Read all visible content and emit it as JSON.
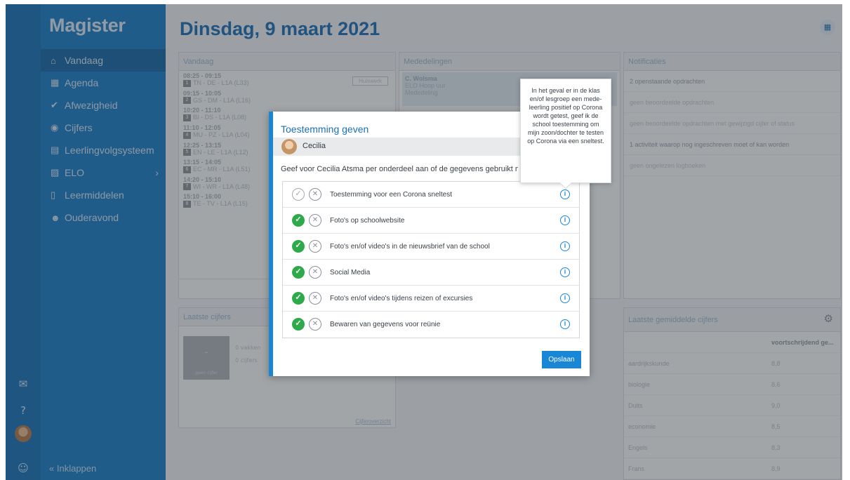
{
  "app": {
    "logo": "Magister",
    "page_title": "Dinsdag, 9 maart 2021"
  },
  "sidebar": {
    "items": [
      {
        "label": "Vandaag",
        "icon": "home-icon"
      },
      {
        "label": "Agenda",
        "icon": "calendar-icon"
      },
      {
        "label": "Afwezigheid",
        "icon": "check-circle-icon"
      },
      {
        "label": "Cijfers",
        "icon": "grades-icon"
      },
      {
        "label": "Leerlingvolgsysteem",
        "icon": "report-icon"
      },
      {
        "label": "ELO",
        "icon": "elo-icon"
      },
      {
        "label": "Leermiddelen",
        "icon": "books-icon"
      },
      {
        "label": "Ouderavond",
        "icon": "parents-icon"
      }
    ],
    "collapse_label": "Inklappen"
  },
  "today": {
    "title": "Vandaag",
    "homework_label": "Huiswerk",
    "lessons": [
      {
        "time": "08:25 - 09:15",
        "num": "1",
        "info": "TN - DE - L1A (L33)"
      },
      {
        "time": "09:15 - 10:05",
        "num": "2",
        "info": "GS - DM - L1A (L16)"
      },
      {
        "time": "10:20 - 11:10",
        "num": "3",
        "info": "BI - DS - L1A (L08)"
      },
      {
        "time": "11:10 - 12:05",
        "num": "4",
        "info": "MU - PZ - L1A (L04)"
      },
      {
        "time": "12:25 - 13:15",
        "num": "5",
        "info": "EN - LE - L1A (L12)"
      },
      {
        "time": "13:15 - 14:05",
        "num": "6",
        "info": "EC - MR - L1A (L51)"
      },
      {
        "time": "14:20 - 15:10",
        "num": "7",
        "info": "WI - WR - L1A (L48)"
      },
      {
        "time": "15:10 - 16:00",
        "num": "8",
        "info": "TE - TV - L1A (L15)"
      }
    ]
  },
  "mededelingen": {
    "title": "Mededelingen",
    "item": {
      "name": "C. Wolsma",
      "line1": "ELO Hoop uur",
      "line2": "Mededeling"
    }
  },
  "notificaties": {
    "title": "Notificaties",
    "rows": [
      {
        "text": "2 openstaande opdrachten",
        "dark": true
      },
      {
        "text": "geen beoordeelde opdrachten",
        "dark": false
      },
      {
        "text": "geen beoordeelde opdrachten met gewijzigd cijfer of status",
        "dark": false
      },
      {
        "text": "1 activiteit waarop nog ingeschreven moet of kan worden",
        "dark": true
      },
      {
        "text": "geen ongelezen logboeken",
        "dark": false
      }
    ]
  },
  "laatste_cijfers": {
    "title": "Laatste cijfers",
    "tile_value": "–",
    "tile_sub": "geen cijfer",
    "link": "Cijferoverzicht",
    "lines": [
      "0 vakken",
      "0 cijfers"
    ]
  },
  "gemiddelde": {
    "title": "Laatste gemiddelde cijfers",
    "column_header": "voortschrijdend ge...",
    "rows": [
      {
        "subject": "aardrijkskunde",
        "value": "8,8"
      },
      {
        "subject": "biologie",
        "value": "8,6"
      },
      {
        "subject": "Duits",
        "value": "9,0"
      },
      {
        "subject": "economie",
        "value": "8,5"
      },
      {
        "subject": "Engels",
        "value": "8,3"
      },
      {
        "subject": "Frans",
        "value": "8,9"
      }
    ]
  },
  "modal": {
    "title": "Toestemming geven",
    "user": "Cecilia",
    "intro": "Geef voor Cecilia Atsma per onderdeel aan of de gegevens gebruikt mogen worden.",
    "items": [
      {
        "label": "Toestemming voor een Corona sneltest",
        "given": false
      },
      {
        "label": "Foto's op schoolwebsite",
        "given": true
      },
      {
        "label": "Foto's en/of video's in de nieuwsbrief van de school",
        "given": true
      },
      {
        "label": "Social Media",
        "given": true
      },
      {
        "label": "Foto's en/of video's tijdens reizen of excursies",
        "given": true
      },
      {
        "label": "Bewaren van gegevens voor reünie",
        "given": true
      }
    ],
    "save_label": "Opslaan"
  },
  "tooltip": {
    "text": "In het geval er in de klas en/of lesgroep een mede-leerling positief op Corona wordt getest, geef ik de school toestemming om mijn zoon/dochter te testen op Corona via een sneltest."
  },
  "icons": {
    "check": "✓",
    "cross": "✕",
    "info": "i",
    "gear": "⚙",
    "chevron": "›",
    "collapse": "«",
    "grid": "▦",
    "mail": "✉",
    "help": "?"
  },
  "colors": {
    "brand_blue": "#1a7ec8",
    "accent_blue": "#1a86d6",
    "consent_green": "#2eaa4a"
  }
}
